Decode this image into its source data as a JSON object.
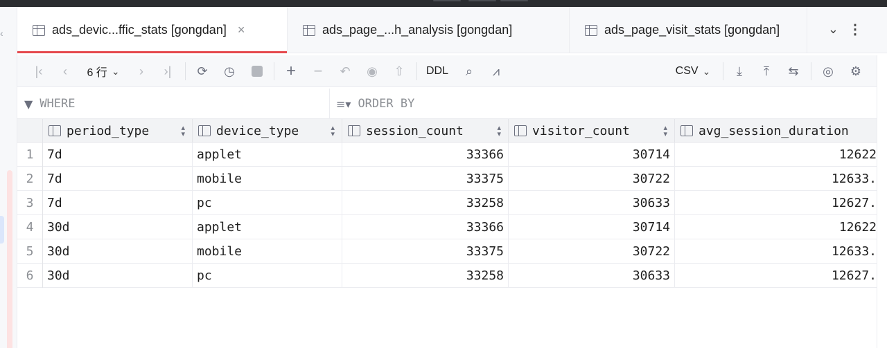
{
  "tabs": [
    {
      "label": "ads_devic...ffic_stats [gongdan]",
      "active": true,
      "closable": true
    },
    {
      "label": "ads_page_...h_analysis [gongdan]",
      "active": false
    },
    {
      "label": "ads_page_visit_stats [gongdan]",
      "active": false
    }
  ],
  "toolbar": {
    "row_count": "6 行",
    "ddl": "DDL",
    "export_format": "CSV"
  },
  "filter": {
    "where": "WHERE",
    "order_by": "ORDER BY"
  },
  "columns": [
    "period_type",
    "device_type",
    "session_count",
    "visitor_count",
    "avg_session_duration"
  ],
  "rows": [
    {
      "n": "1",
      "period_type": "7d",
      "device_type": "applet",
      "session_count": "33366",
      "visitor_count": "30714",
      "avg_session_duration": "12622"
    },
    {
      "n": "2",
      "period_type": "7d",
      "device_type": "mobile",
      "session_count": "33375",
      "visitor_count": "30722",
      "avg_session_duration": "12633."
    },
    {
      "n": "3",
      "period_type": "7d",
      "device_type": "pc",
      "session_count": "33258",
      "visitor_count": "30633",
      "avg_session_duration": "12627."
    },
    {
      "n": "4",
      "period_type": "30d",
      "device_type": "applet",
      "session_count": "33366",
      "visitor_count": "30714",
      "avg_session_duration": "12622"
    },
    {
      "n": "5",
      "period_type": "30d",
      "device_type": "mobile",
      "session_count": "33375",
      "visitor_count": "30722",
      "avg_session_duration": "12633."
    },
    {
      "n": "6",
      "period_type": "30d",
      "device_type": "pc",
      "session_count": "33258",
      "visitor_count": "30633",
      "avg_session_duration": "12627."
    }
  ],
  "colors": {
    "active_tab_accent": "#e5484d"
  }
}
